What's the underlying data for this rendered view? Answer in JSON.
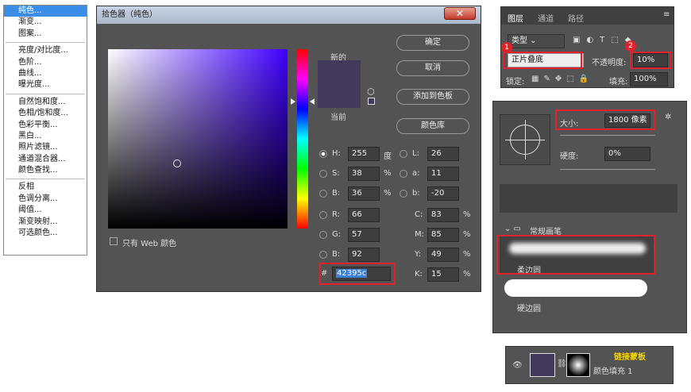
{
  "menu": {
    "items": [
      "纯色...",
      "渐变...",
      "图案...",
      "亮度/对比度...",
      "色阶...",
      "曲线...",
      "曝光度...",
      "自然饱和度...",
      "色相/饱和度...",
      "色彩平衡...",
      "黑白...",
      "照片滤镜...",
      "通道混合器...",
      "颜色查找...",
      "反相",
      "色调分离...",
      "阈值...",
      "渐变映射...",
      "可选颜色..."
    ]
  },
  "picker": {
    "title": "拾色器（纯色）",
    "new_label": "新的",
    "current_label": "当前",
    "buttons": {
      "ok": "确定",
      "cancel": "取消",
      "add_swatch": "添加到色板",
      "library": "颜色库"
    },
    "fields": {
      "H": "255",
      "H_unit": "度",
      "S": "38",
      "S_unit": "%",
      "B": "36",
      "B_unit": "%",
      "R": "66",
      "G": "57",
      "Bv": "92",
      "L": "26",
      "a": "11",
      "b": "-20",
      "C": "83",
      "M": "85",
      "Y": "49",
      "K": "15",
      "pct": "%"
    },
    "hex_label": "#",
    "hex": "42395c",
    "web_only": "只有 Web 颜色",
    "swatch_color": "#42395c"
  },
  "layers": {
    "tabs": [
      "图层",
      "通道",
      "路径"
    ],
    "kind": "类型",
    "blend": "正片叠底",
    "opacity_label": "不透明度:",
    "opacity": "10%",
    "lock_label": "锁定:",
    "fill_label": "填充:",
    "fill": "100%",
    "badges": [
      "1",
      "2"
    ]
  },
  "brush": {
    "size_label": "大小:",
    "size": "1800 像素",
    "hardness_label": "硬度:",
    "hardness": "0%",
    "group": "常规画笔",
    "soft": "柔边圆",
    "hard": "硬边圆"
  },
  "layer_row": {
    "link_label": "链接蒙板",
    "layer_name": "颜色填充 1"
  }
}
